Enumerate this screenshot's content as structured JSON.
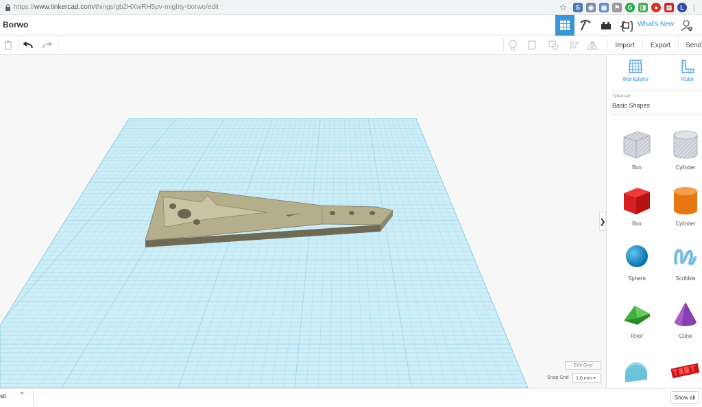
{
  "browser": {
    "url_scheme": "https://",
    "url_host": "www.tinkercad.com",
    "url_path": "/things/gb2HXwRH5pv-mighty-borwo/edit"
  },
  "header": {
    "title": "Borwo",
    "whats_new": "What's New",
    "accent": "#3c95d6"
  },
  "toolbar": {
    "import_label": "Import",
    "export_label": "Export",
    "send_label": "Send T"
  },
  "panel": {
    "workplane_label": "Workplane",
    "ruler_label": "Ruler",
    "library_source": "Tinkercad",
    "library_name": "Basic Shapes",
    "shapes": [
      {
        "label": "Box",
        "style": "hole"
      },
      {
        "label": "Cylinder",
        "style": "hole"
      },
      {
        "label": "Box",
        "style": "red"
      },
      {
        "label": "Cylinder",
        "style": "orange"
      },
      {
        "label": "Sphere",
        "style": "blue"
      },
      {
        "label": "Scribble",
        "style": "light-blue"
      },
      {
        "label": "Roof",
        "style": "green"
      },
      {
        "label": "Cone",
        "style": "purple"
      }
    ]
  },
  "workspace": {
    "edit_grid_label": "Edit Grid",
    "snap_grid_label": "Snap Grid",
    "snap_grid_value": "1.0 mm ▾",
    "collapse_glyph": "❯",
    "model_color": "#b5ae8c",
    "grid_color": "#bfe6f2"
  },
  "downloads": {
    "item_label": "stl",
    "chevron": "^",
    "show_all": "Show all"
  }
}
